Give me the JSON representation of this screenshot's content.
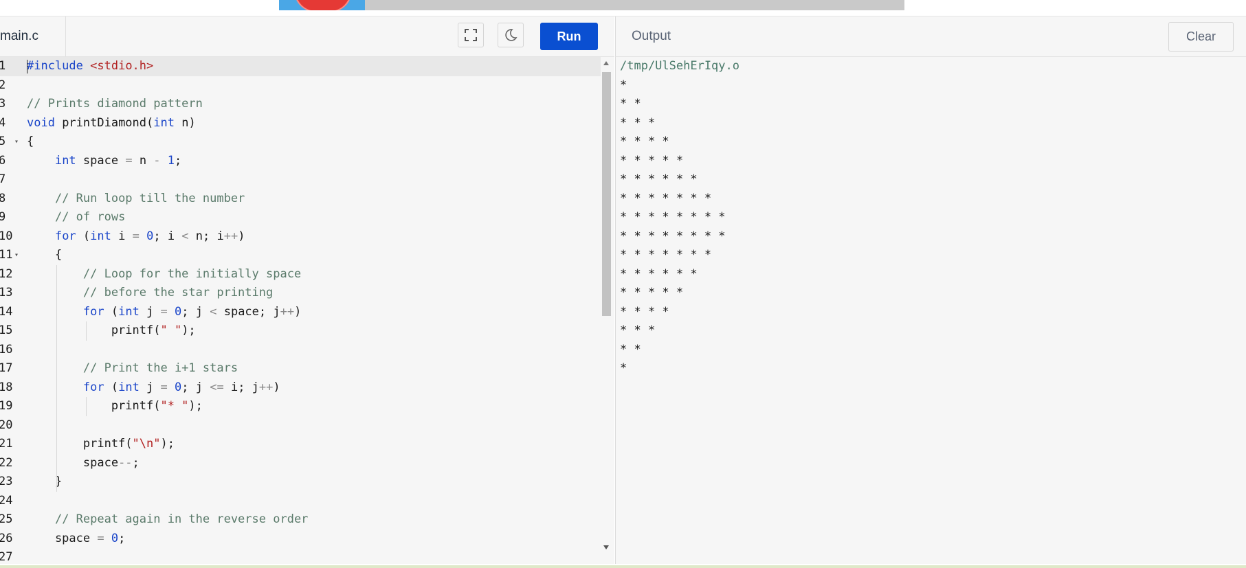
{
  "banner": {},
  "editor": {
    "file_tab": "main.c",
    "run_label": "Run",
    "icons": [
      "fullscreen-icon",
      "dark-mode-icon"
    ],
    "lines": [
      {
        "n": "1",
        "fold": false,
        "html": "<span class=\"tk-pp\">#include</span> <span class=\"tk-str\">&lt;stdio.h&gt;</span>"
      },
      {
        "n": "2",
        "fold": false,
        "html": ""
      },
      {
        "n": "3",
        "fold": false,
        "html": "<span class=\"tk-cm\">// Prints diamond pattern</span>"
      },
      {
        "n": "4",
        "fold": false,
        "html": "<span class=\"tk-kw\">void</span> printDiamond(<span class=\"tk-kw\">int</span> n)"
      },
      {
        "n": "5",
        "fold": true,
        "html": "{"
      },
      {
        "n": "6",
        "fold": false,
        "html": "    <span class=\"tk-kw\">int</span> space <span class=\"tk-op\">=</span> n <span class=\"tk-op\">-</span> <span class=\"tk-num\">1</span>;"
      },
      {
        "n": "7",
        "fold": false,
        "html": ""
      },
      {
        "n": "8",
        "fold": false,
        "html": "    <span class=\"tk-cm\">// Run loop till the number</span>"
      },
      {
        "n": "9",
        "fold": false,
        "html": "    <span class=\"tk-cm\">// of rows</span>"
      },
      {
        "n": "10",
        "fold": false,
        "html": "    <span class=\"tk-kw\">for</span> (<span class=\"tk-kw\">int</span> i <span class=\"tk-op\">=</span> <span class=\"tk-num\">0</span>; i <span class=\"tk-op\">&lt;</span> n; i<span class=\"tk-op\">++</span>)"
      },
      {
        "n": "11",
        "fold": true,
        "html": "    {"
      },
      {
        "n": "12",
        "fold": false,
        "html": "        <span class=\"tk-cm\">// Loop for the initially space</span>"
      },
      {
        "n": "13",
        "fold": false,
        "html": "        <span class=\"tk-cm\">// before the star printing</span>"
      },
      {
        "n": "14",
        "fold": false,
        "html": "        <span class=\"tk-kw\">for</span> (<span class=\"tk-kw\">int</span> j <span class=\"tk-op\">=</span> <span class=\"tk-num\">0</span>; j <span class=\"tk-op\">&lt;</span> space; j<span class=\"tk-op\">++</span>)"
      },
      {
        "n": "15",
        "fold": false,
        "html": "            printf(<span class=\"tk-str\">\" \"</span>);"
      },
      {
        "n": "16",
        "fold": false,
        "html": ""
      },
      {
        "n": "17",
        "fold": false,
        "html": "        <span class=\"tk-cm\">// Print the i+1 stars</span>"
      },
      {
        "n": "18",
        "fold": false,
        "html": "        <span class=\"tk-kw\">for</span> (<span class=\"tk-kw\">int</span> j <span class=\"tk-op\">=</span> <span class=\"tk-num\">0</span>; j <span class=\"tk-op\">&lt;=</span> i; j<span class=\"tk-op\">++</span>)"
      },
      {
        "n": "19",
        "fold": false,
        "html": "            printf(<span class=\"tk-str\">\"* \"</span>);"
      },
      {
        "n": "20",
        "fold": false,
        "html": ""
      },
      {
        "n": "21",
        "fold": false,
        "html": "        printf(<span class=\"tk-str\">\"\\n\"</span>);"
      },
      {
        "n": "22",
        "fold": false,
        "html": "        space<span class=\"tk-op\">--</span>;"
      },
      {
        "n": "23",
        "fold": false,
        "html": "    }"
      },
      {
        "n": "24",
        "fold": false,
        "html": ""
      },
      {
        "n": "25",
        "fold": false,
        "html": "    <span class=\"tk-cm\">// Repeat again in the reverse order</span>"
      },
      {
        "n": "26",
        "fold": false,
        "html": "    space <span class=\"tk-op\">=</span> <span class=\"tk-num\">0</span>;"
      },
      {
        "n": "27",
        "fold": false,
        "html": ""
      }
    ]
  },
  "output": {
    "title": "Output",
    "clear_label": "Clear",
    "path": "/tmp/UlSehErIqy.o",
    "lines": [
      "*",
      "* *",
      "* * *",
      "* * * *",
      "* * * * *",
      "* * * * * *",
      "* * * * * * *",
      "* * * * * * * *",
      "* * * * * * * *",
      "* * * * * * *",
      "* * * * * *",
      "* * * * *",
      "* * * *",
      "* * *",
      "* *",
      "*"
    ]
  },
  "colors": {
    "run_button": "#0a4fd1",
    "keyword": "#1a45c9",
    "string": "#b22222",
    "comment": "#5a7a6a"
  }
}
